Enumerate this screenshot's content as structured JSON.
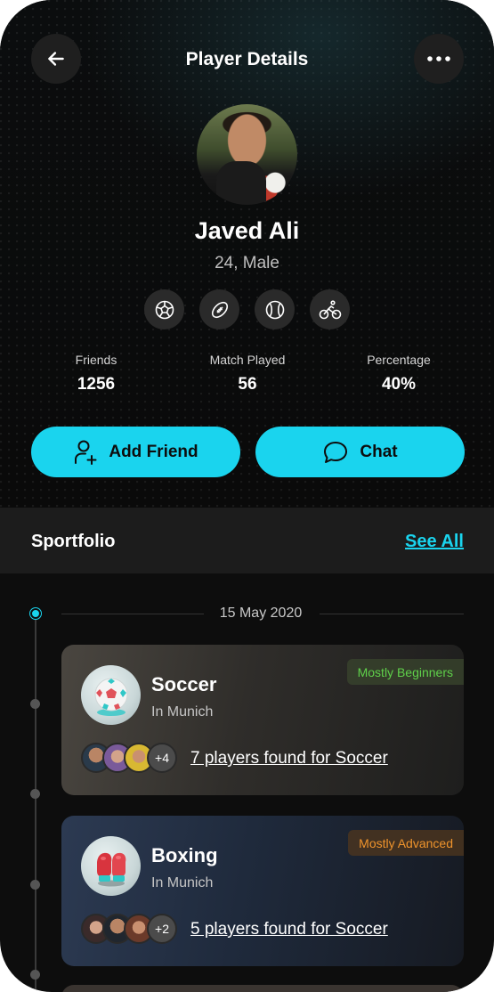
{
  "header": {
    "title": "Player Details",
    "back_icon": "arrow-left-icon",
    "more_icon": "more-horizontal-icon"
  },
  "profile": {
    "name": "Javed Ali",
    "subtitle": "24, Male",
    "sports_icons": [
      "soccer-ball-icon",
      "football-icon",
      "baseball-icon",
      "cycling-icon"
    ]
  },
  "stats": [
    {
      "label": "Friends",
      "value": "1256"
    },
    {
      "label": "Match Played",
      "value": "56"
    },
    {
      "label": "Percentage",
      "value": "40%"
    }
  ],
  "actions": {
    "add_friend": "Add Friend",
    "chat": "Chat"
  },
  "sportfolio": {
    "title": "Sportfolio",
    "see_all": "See All",
    "date": "15 May 2020",
    "cards": [
      {
        "sport": "Soccer",
        "location": "In Munich",
        "badge": "Mostly Beginners",
        "more_count": "+4",
        "found_text": "7 players found for Soccer"
      },
      {
        "sport": "Boxing",
        "location": "In Munich",
        "badge": "Mostly Advanced",
        "more_count": "+2",
        "found_text": "5 players found for Soccer"
      }
    ]
  },
  "colors": {
    "accent": "#1ad4ee",
    "background": "#0d0d0d",
    "beginner_badge": "#5fd04a",
    "advanced_badge": "#f0942c"
  }
}
